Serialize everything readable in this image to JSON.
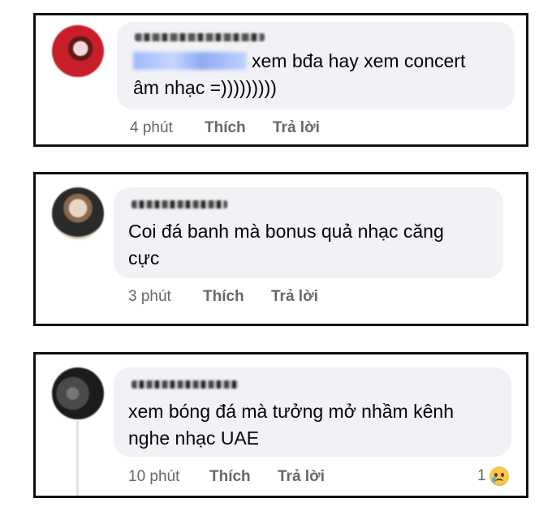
{
  "comments": [
    {
      "tag_text": "",
      "text_line1": "xem bđa hay xem concert",
      "text_line2": "âm nhạc =)))))))))",
      "time": "4 phút",
      "like_label": "Thích",
      "reply_label": "Trả lời",
      "avatar_colors": [
        "#c81e2a",
        "#f2d9d5",
        "#5b1a1a"
      ]
    },
    {
      "text_line1": "Coi đá banh mà bonus quả nhạc căng",
      "text_line2": "cực",
      "time": "3 phút",
      "like_label": "Thích",
      "reply_label": "Trả lời",
      "avatar_colors": [
        "#2b2b2b",
        "#e6d7c6",
        "#8a6a4d"
      ]
    },
    {
      "text_line1": "xem bóng đá mà tưởng mở nhầm kênh",
      "text_line2": "nghe nhạc UAE",
      "time": "10 phút",
      "like_label": "Thích",
      "reply_label": "Trả lời",
      "reaction_count": "1",
      "reaction_icon": "crying-face-icon",
      "avatar_colors": [
        "#1b1b1b",
        "#4a4a4a",
        "#777777"
      ]
    }
  ],
  "colors": {
    "bubble": "#f0f2f5",
    "action_text": "#65676b",
    "text": "#050505",
    "border": "#111111"
  }
}
